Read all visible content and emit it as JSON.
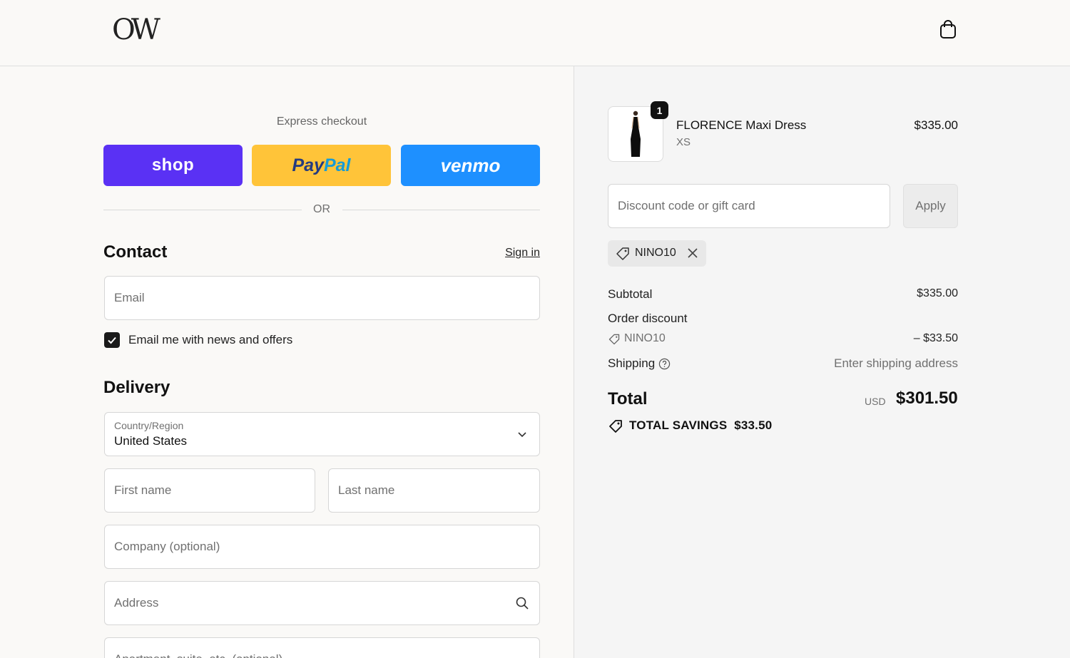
{
  "header": {
    "logo_text": "OW",
    "cart_icon": "shopping-bag-icon"
  },
  "express": {
    "title": "Express checkout",
    "shop_label": "shop",
    "paypal_label_1": "Pay",
    "paypal_label_2": "Pal",
    "venmo_label": "venmo",
    "colors": {
      "shop": "#5a31f4",
      "paypal": "#ffc439",
      "venmo": "#1e90ff"
    },
    "or_label": "OR"
  },
  "contact": {
    "title": "Contact",
    "signin_label": "Sign in",
    "email_placeholder": "Email",
    "newsletter_label": "Email me with news and offers",
    "newsletter_checked": true
  },
  "delivery": {
    "title": "Delivery",
    "country_label": "Country/Region",
    "country_value": "United States",
    "first_name_placeholder": "First name",
    "last_name_placeholder": "Last name",
    "company_placeholder": "Company (optional)",
    "address_placeholder": "Address",
    "apartment_placeholder": "Apartment, suite, etc. (optional)"
  },
  "summary": {
    "product": {
      "name": "FLORENCE Maxi Dress",
      "variant": "XS",
      "price": "$335.00",
      "quantity": "1"
    },
    "discount_placeholder": "Discount code or gift card",
    "apply_label": "Apply",
    "applied_code": "NINO10",
    "subtotal_label": "Subtotal",
    "subtotal_value": "$335.00",
    "order_discount_label": "Order discount",
    "discount_code": "NINO10",
    "discount_value": "– $33.50",
    "shipping_label": "Shipping",
    "shipping_value": "Enter shipping address",
    "total_label": "Total",
    "total_currency": "USD",
    "total_value": "$301.50",
    "savings_label": "TOTAL SAVINGS",
    "savings_value": "$33.50"
  }
}
